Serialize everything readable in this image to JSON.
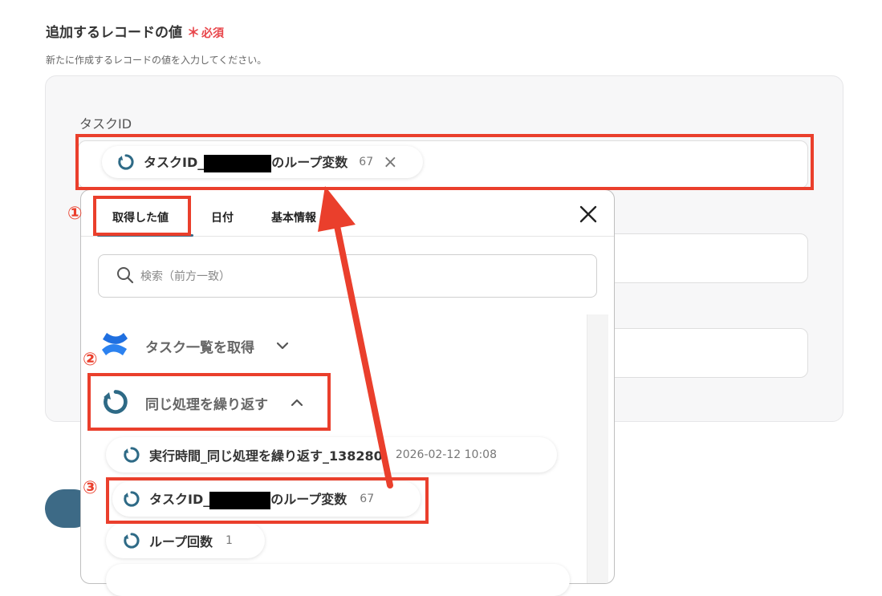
{
  "section": {
    "title": "追加するレコードの値",
    "required_star": "＊",
    "required_text": "必須",
    "description": "新たに作成するレコードの値を入力してください。"
  },
  "field": {
    "label": "タスクID",
    "chip": {
      "text_prefix": "タスクID_",
      "text_suffix": "のループ変数",
      "value": "67",
      "remove_glyph": "×"
    }
  },
  "panel": {
    "tabs": [
      "取得した値",
      "日付",
      "基本情報"
    ],
    "close_glyph": "×",
    "search": {
      "placeholder": "検索（前方一致）"
    },
    "groups": [
      {
        "label": "タスク一覧を取得",
        "icon": "confluence-icon",
        "expanded": false
      },
      {
        "label": "同じ処理を繰り返す",
        "icon": "loop-icon",
        "expanded": true
      }
    ],
    "items": [
      {
        "label": "実行時間_同じ処理を繰り返す_138280",
        "value": "2026-02-12 10:08"
      },
      {
        "label_prefix": "タスクID_",
        "label_suffix": "のループ変数",
        "value": "67"
      },
      {
        "label": "ループ回数",
        "value": "1"
      }
    ]
  },
  "annotations": {
    "step1": "①",
    "step2": "②",
    "step3": "③",
    "color": "#ea3f2c"
  },
  "colors": {
    "loop_icon": "#2e6a86",
    "accent": "#3d6a86",
    "required": "#e8454a"
  }
}
